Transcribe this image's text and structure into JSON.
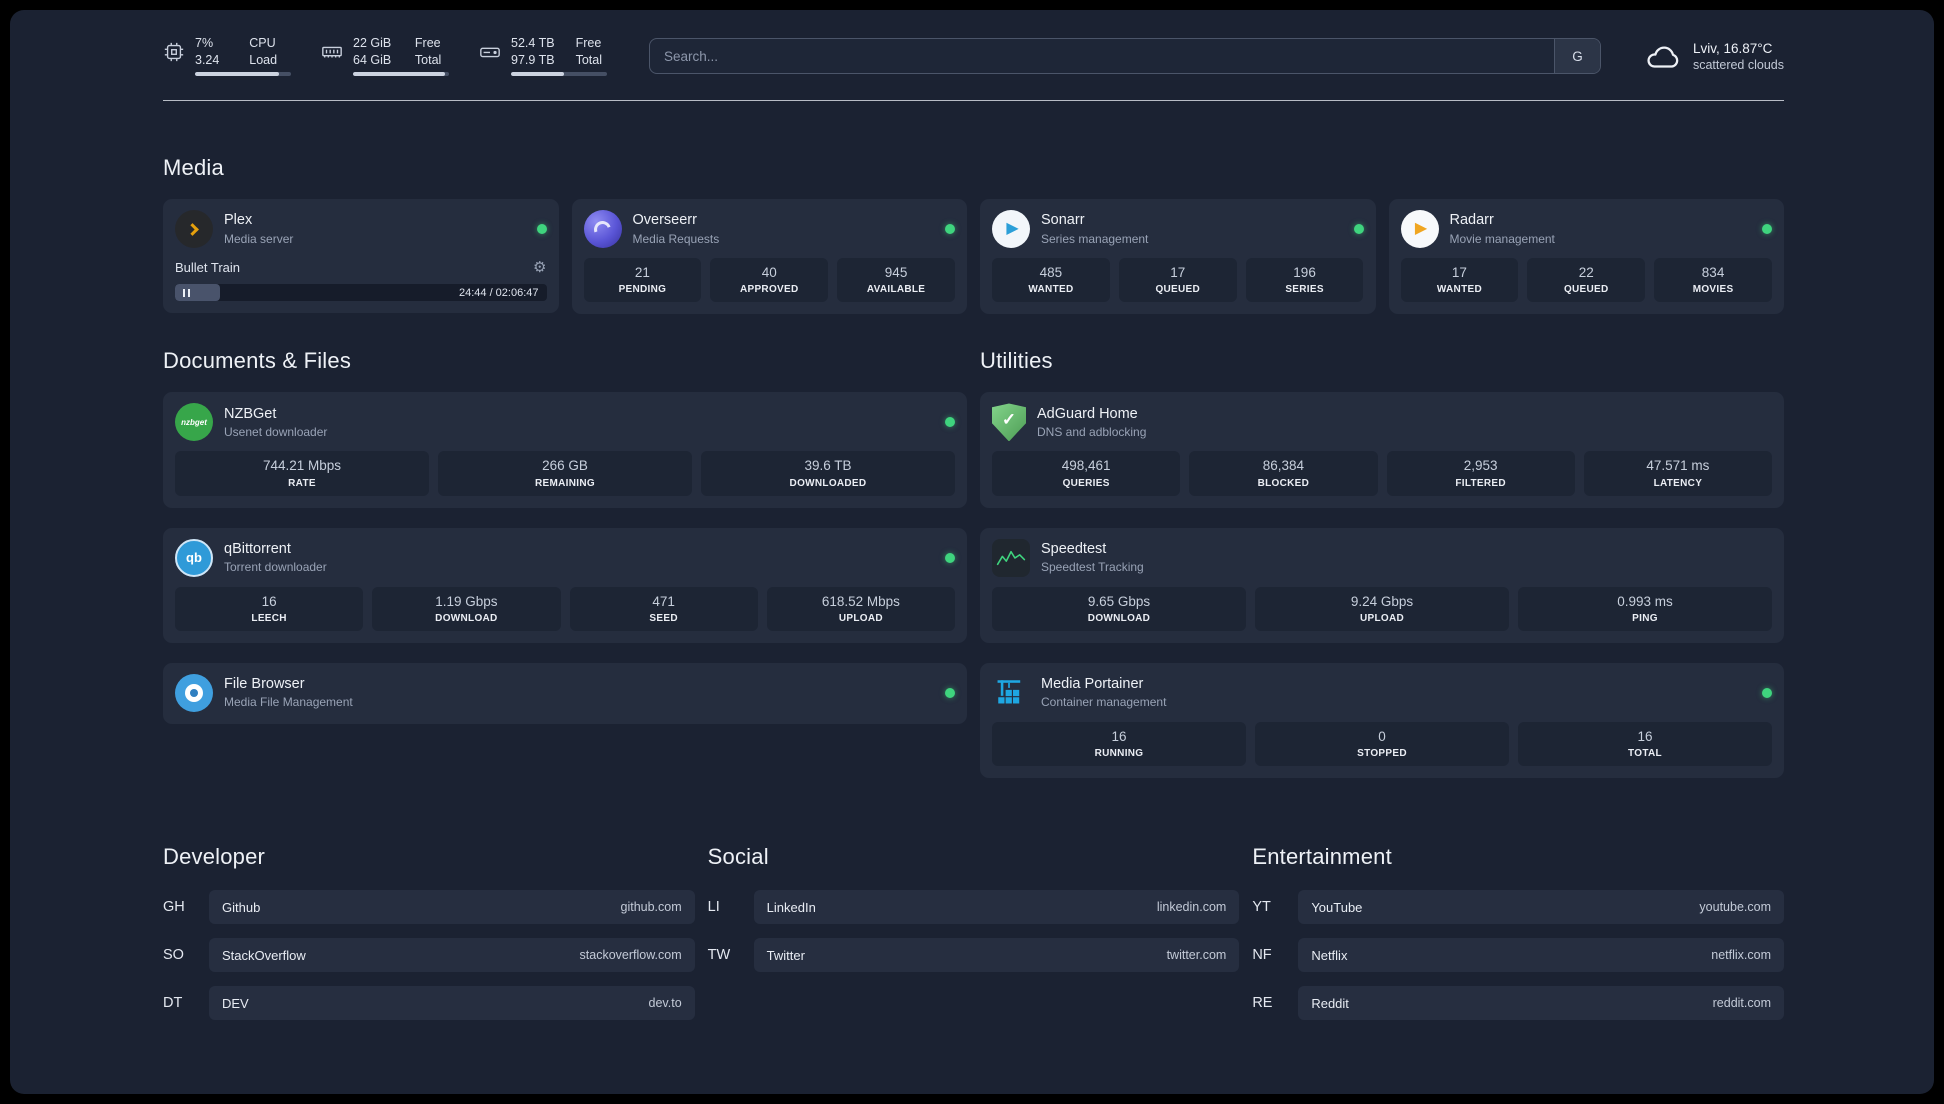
{
  "topbar": {
    "resources": {
      "cpu": {
        "top_value": "7%",
        "top_label": "CPU",
        "bottom_value": "3.24",
        "bottom_label": "Load",
        "bar_percent": 88
      },
      "memory": {
        "top_value": "22 GiB",
        "top_label": "Free",
        "bottom_value": "64 GiB",
        "bottom_label": "Total",
        "bar_percent": 96
      },
      "disk": {
        "top_value": "52.4 TB",
        "top_label": "Free",
        "bottom_value": "97.9 TB",
        "bottom_label": "Total",
        "bar_percent": 55
      }
    },
    "search": {
      "placeholder": "Search...",
      "provider_button": "G"
    },
    "weather": {
      "location": "Lviv, 16.87°C",
      "condition": "scattered clouds"
    }
  },
  "sections": {
    "media": {
      "title": "Media",
      "plex": {
        "name": "Plex",
        "description": "Media server",
        "now_playing": {
          "title": "Bullet Train",
          "time": "24:44 / 02:06:47",
          "progress_percent": 12
        }
      },
      "overseerr": {
        "name": "Overseerr",
        "description": "Media Requests",
        "stats": [
          {
            "value": "21",
            "label": "PENDING"
          },
          {
            "value": "40",
            "label": "APPROVED"
          },
          {
            "value": "945",
            "label": "AVAILABLE"
          }
        ]
      },
      "sonarr": {
        "name": "Sonarr",
        "description": "Series management",
        "stats": [
          {
            "value": "485",
            "label": "WANTED"
          },
          {
            "value": "17",
            "label": "QUEUED"
          },
          {
            "value": "196",
            "label": "SERIES"
          }
        ]
      },
      "radarr": {
        "name": "Radarr",
        "description": "Movie management",
        "stats": [
          {
            "value": "17",
            "label": "WANTED"
          },
          {
            "value": "22",
            "label": "QUEUED"
          },
          {
            "value": "834",
            "label": "MOVIES"
          }
        ]
      }
    },
    "documents": {
      "title": "Documents & Files",
      "nzbget": {
        "name": "NZBGet",
        "description": "Usenet downloader",
        "stats": [
          {
            "value": "744.21 Mbps",
            "label": "RATE"
          },
          {
            "value": "266 GB",
            "label": "REMAINING"
          },
          {
            "value": "39.6 TB",
            "label": "DOWNLOADED"
          }
        ]
      },
      "qbittorrent": {
        "name": "qBittorrent",
        "description": "Torrent downloader",
        "stats": [
          {
            "value": "16",
            "label": "LEECH"
          },
          {
            "value": "1.19 Gbps",
            "label": "DOWNLOAD"
          },
          {
            "value": "471",
            "label": "SEED"
          },
          {
            "value": "618.52 Mbps",
            "label": "UPLOAD"
          }
        ]
      },
      "filebrowser": {
        "name": "File Browser",
        "description": "Media File Management"
      }
    },
    "utilities": {
      "title": "Utilities",
      "adguard": {
        "name": "AdGuard Home",
        "description": "DNS and adblocking",
        "stats": [
          {
            "value": "498,461",
            "label": "QUERIES"
          },
          {
            "value": "86,384",
            "label": "BLOCKED"
          },
          {
            "value": "2,953",
            "label": "FILTERED"
          },
          {
            "value": "47.571 ms",
            "label": "LATENCY"
          }
        ]
      },
      "speedtest": {
        "name": "Speedtest",
        "description": "Speedtest Tracking",
        "stats": [
          {
            "value": "9.65 Gbps",
            "label": "DOWNLOAD"
          },
          {
            "value": "9.24 Gbps",
            "label": "UPLOAD"
          },
          {
            "value": "0.993 ms",
            "label": "PING"
          }
        ]
      },
      "portainer": {
        "name": "Media Portainer",
        "description": "Container management",
        "stats": [
          {
            "value": "16",
            "label": "RUNNING"
          },
          {
            "value": "0",
            "label": "STOPPED"
          },
          {
            "value": "16",
            "label": "TOTAL"
          }
        ]
      }
    },
    "bookmarks": {
      "developer": {
        "title": "Developer",
        "items": [
          {
            "abbr": "GH",
            "name": "Github",
            "domain": "github.com"
          },
          {
            "abbr": "SO",
            "name": "StackOverflow",
            "domain": "stackoverflow.com"
          },
          {
            "abbr": "DT",
            "name": "DEV",
            "domain": "dev.to"
          }
        ]
      },
      "social": {
        "title": "Social",
        "items": [
          {
            "abbr": "LI",
            "name": "LinkedIn",
            "domain": "linkedin.com"
          },
          {
            "abbr": "TW",
            "name": "Twitter",
            "domain": "twitter.com"
          }
        ]
      },
      "entertainment": {
        "title": "Entertainment",
        "items": [
          {
            "abbr": "YT",
            "name": "YouTube",
            "domain": "youtube.com"
          },
          {
            "abbr": "NF",
            "name": "Netflix",
            "domain": "netflix.com"
          },
          {
            "abbr": "RE",
            "name": "Reddit",
            "domain": "reddit.com"
          }
        ]
      }
    }
  },
  "colors": {
    "status_online": "#3fd47e"
  }
}
